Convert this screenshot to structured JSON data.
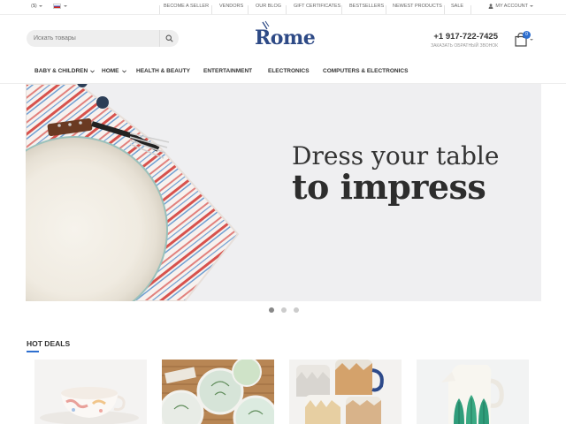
{
  "topbar": {
    "currency": "($)",
    "links": [
      "Become a seller",
      "Vendors",
      "Our blog",
      "Gift certificates",
      "Bestsellers",
      "Newest products",
      "Sale"
    ],
    "account": "My Account"
  },
  "header": {
    "search_placeholder": "Искать товары",
    "logo": "Rome",
    "phone": "+1 917-722-7425",
    "callback": "Заказать обратный звонок",
    "cart_count": "0"
  },
  "nav": {
    "items": [
      {
        "label": "Baby & Children",
        "dropdown": true
      },
      {
        "label": "Home",
        "dropdown": true
      },
      {
        "label": "Health & Beauty",
        "dropdown": false
      },
      {
        "label": "Entertainment",
        "dropdown": false
      },
      {
        "label": "Electronics",
        "dropdown": false
      },
      {
        "label": "Computers & Electronics",
        "dropdown": false
      }
    ]
  },
  "hero": {
    "line1": "Dress your table",
    "line2": "to impress",
    "slides": 3,
    "active_slide": 1
  },
  "deals": {
    "title": "Hot Deals"
  },
  "colors": {
    "accent": "#2e6fcf",
    "logo": "#2e4a86"
  }
}
